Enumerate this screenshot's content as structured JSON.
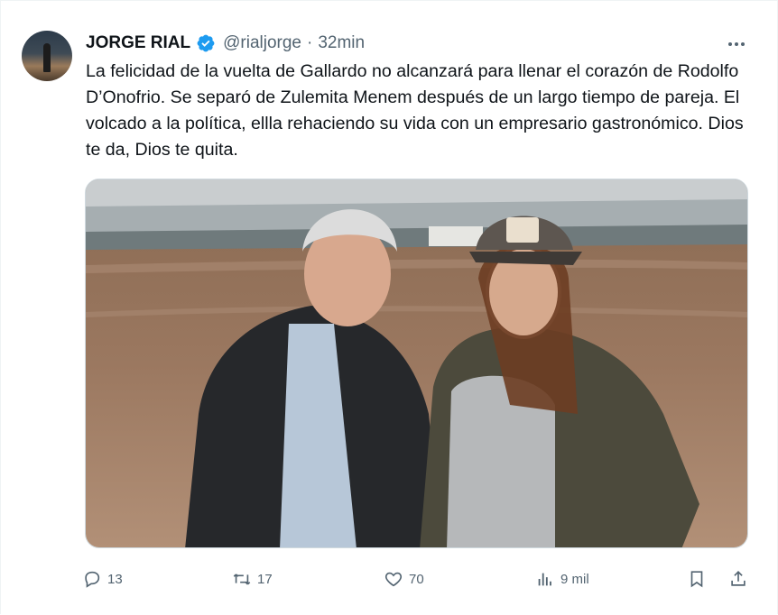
{
  "tweet": {
    "author_name": "JORGE RIAL",
    "handle": "@rialjorge",
    "separator": "·",
    "time": "32min",
    "text": "La felicidad de la vuelta de Gallardo no alcanzará para llenar el corazón de Rodolfo D’Onofrio. Se separó de Zulemita Menem después de un largo tiempo de pareja. El volcado a la política, ellla rehaciendo su vida con un empresario gastronómico. Dios te da, Dios te quita.",
    "verified_badge_color": "#1d9bf0",
    "avatar_icon": "avatar-photo",
    "media_icon": "photo-stadium-couple"
  },
  "actions": {
    "replies": "13",
    "retweets": "17",
    "likes": "70",
    "views": "9 mil"
  },
  "icons": {
    "reply": "comment-icon",
    "retweet": "retweet-icon",
    "like": "heart-icon",
    "views": "bar-chart-icon",
    "bookmark": "bookmark-icon",
    "share": "share-icon",
    "more": "more-icon"
  },
  "colors": {
    "text": "#0f1419",
    "secondary": "#536471",
    "border": "#cfd9de"
  }
}
